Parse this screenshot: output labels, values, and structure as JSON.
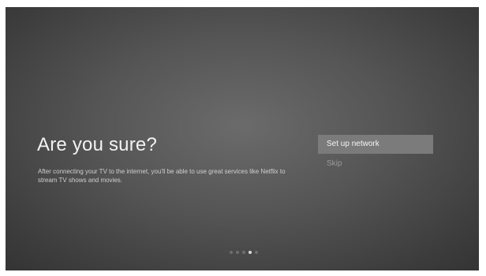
{
  "screen": {
    "title": "Are you sure?",
    "description": "After connecting your TV to the internet, you'll be able to use great services like Netflix to stream TV shows and movies."
  },
  "menu": {
    "items": [
      {
        "label": "Set up network",
        "focused": true
      },
      {
        "label": "Skip",
        "focused": false
      }
    ]
  },
  "pager": {
    "total": 5,
    "current": 4
  },
  "colors": {
    "background": "#555555",
    "focus_highlight": "#7b7b7b"
  }
}
